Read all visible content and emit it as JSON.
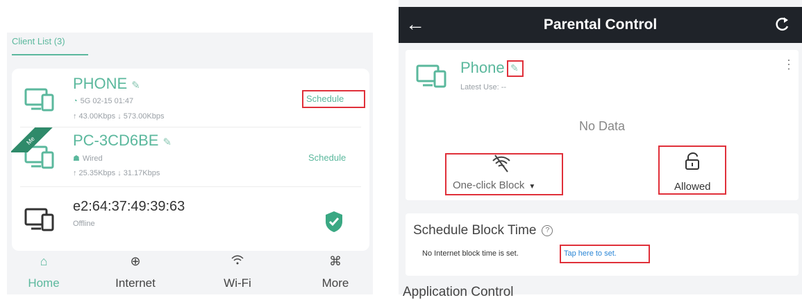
{
  "left_panel": {
    "client_tab": "Client List (3)",
    "devices": [
      {
        "name": "PHONE",
        "line1": "5G 02-15 01:47",
        "line2": "↑ 43.00Kbps ↓ 573.00Kbps",
        "schedule": "Schedule"
      },
      {
        "name": "PC-3CD6BE",
        "line1": "Wired",
        "line2": "↑ 25.35Kbps ↓ 31.17Kbps",
        "schedule": "Schedule",
        "ribbon": "Me"
      },
      {
        "name": "e2:64:37:49:39:63",
        "line1": "Offline"
      }
    ],
    "nav": [
      {
        "label": "Home",
        "icon": "home-icon"
      },
      {
        "label": "Internet",
        "icon": "globe-icon"
      },
      {
        "label": "Wi-Fi",
        "icon": "wifi-icon"
      },
      {
        "label": "More",
        "icon": "more-icon"
      }
    ]
  },
  "right_panel": {
    "title": "Parental Control",
    "device_name": "Phone",
    "latest_use": "Latest Use: --",
    "no_data": "No Data",
    "block_label": "One-click Block",
    "allowed_label": "Allowed",
    "schedule_title": "Schedule Block Time",
    "no_block_text": "No Internet block time is set.",
    "tap_here": "Tap here to set.",
    "application_control": "Application Control"
  },
  "colors": {
    "accent": "#5bb89d",
    "highlight": "#e0303a",
    "topbar": "#1f2329",
    "link": "#2b86d6"
  }
}
